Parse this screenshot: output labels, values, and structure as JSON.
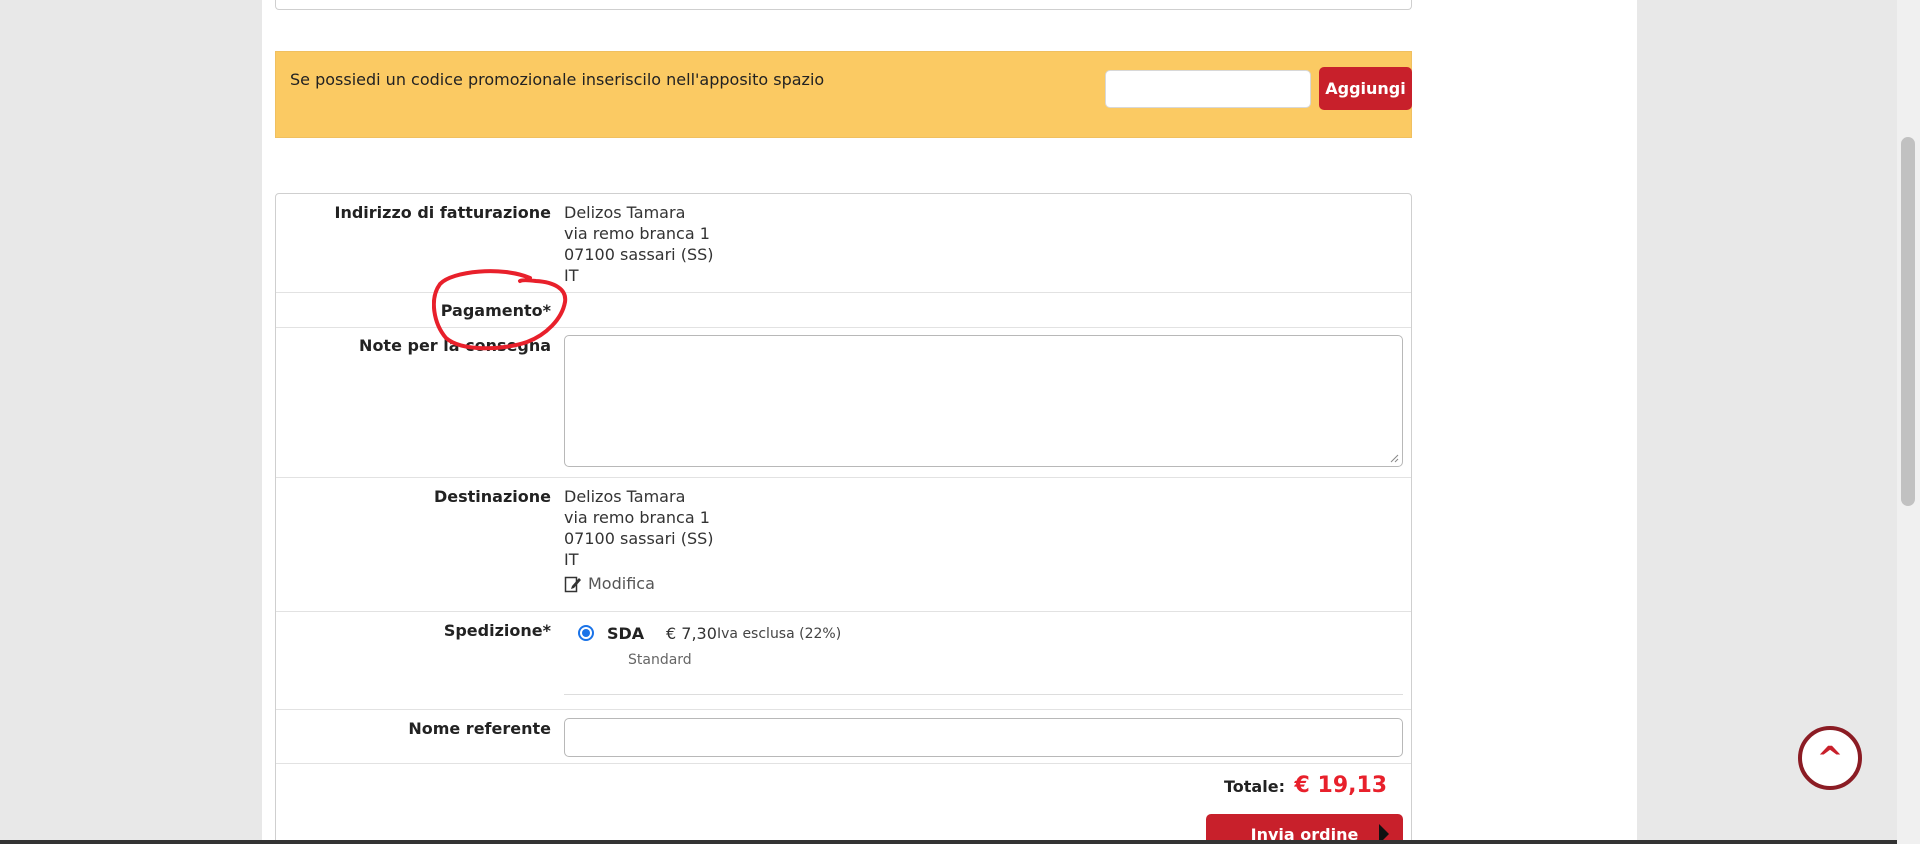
{
  "promo": {
    "text": "Se possiedi un codice promozionale inseriscilo nell'apposito spazio",
    "input_value": "",
    "button_label": "Aggiungi"
  },
  "billing": {
    "label": "Indirizzo di fatturazione",
    "lines": [
      "Delizos Tamara",
      "via remo branca 1",
      "07100 sassari (SS)",
      "IT"
    ]
  },
  "payment": {
    "label": "Pagamento*"
  },
  "notes": {
    "label": "Note per la consegna",
    "value": ""
  },
  "destination": {
    "label": "Destinazione",
    "lines": [
      "Delizos Tamara",
      "via remo branca 1",
      "07100 sassari (SS)",
      "IT"
    ],
    "edit_label": "Modifica"
  },
  "shipping": {
    "label": "Spedizione*",
    "carrier": "SDA",
    "price": "€ 7,30",
    "vat_note": "Iva esclusa (22%)",
    "service": "Standard",
    "selected": true
  },
  "contact": {
    "label": "Nome referente",
    "value": ""
  },
  "total": {
    "label": "Totale:",
    "amount": "€ 19,13"
  },
  "submit": {
    "label": "Invia ordine"
  },
  "scroll_top": {
    "glyph": "^"
  },
  "colors": {
    "promo_bg": "#fbca63",
    "brand_red": "#c8202b",
    "annotation": "#e8202b",
    "radio_blue": "#1a73e8"
  }
}
